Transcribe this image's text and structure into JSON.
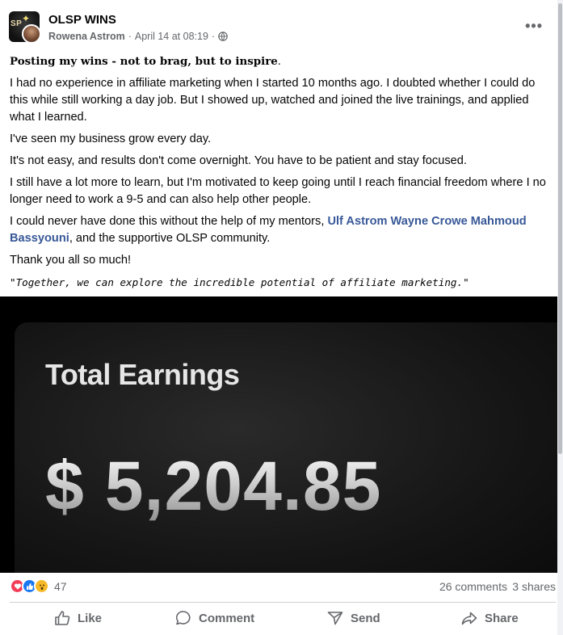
{
  "header": {
    "group_name": "OLSP WINS",
    "group_avatar_text": "SP",
    "author": "Rowena Astrom",
    "separator": "·",
    "timestamp": "April 14 at 08:19",
    "more_icon": "more-horizontal-icon"
  },
  "post": {
    "headline": "Posting my wins - not to brag, but to inspire",
    "headline_end": ".",
    "p1": "I had no experience in affiliate marketing when I started 10 months ago. I doubted whether I could do this while still working a day job. But I showed up, watched and joined the live trainings, and applied what I learned.",
    "p2": "I've seen my business grow every day.",
    "p3": "It's not easy, and results don't come overnight. You have to be patient and stay focused.",
    "p4": "I still have a lot more to learn, but I'm motivated to keep going until I reach financial freedom where I no longer need to work a 9-5 and can also help other people.",
    "p5_start": "I could never have done this without the help of my mentors, ",
    "mentions": "Ulf Astrom Wayne Crowe Mahmoud Bassyouni",
    "p5_end": ", and the supportive OLSP community.",
    "p6": "Thank you all so much!",
    "quote": "\"Together, we can explore the incredible potential of affiliate marketing.\""
  },
  "media": {
    "title": "Total Earnings",
    "value": "$ 5,204.85"
  },
  "stats": {
    "reactions": [
      "love-icon",
      "like-icon",
      "wow-icon"
    ],
    "reaction_count": "47",
    "comments": "26 comments",
    "shares": "3 shares"
  },
  "actions": {
    "like": "Like",
    "comment": "Comment",
    "send": "Send",
    "share": "Share"
  },
  "colors": {
    "mention": "#385898",
    "meta_gray": "#65676b",
    "love": "#f33e58",
    "like": "#1877f2",
    "wow": "#f7b928"
  }
}
